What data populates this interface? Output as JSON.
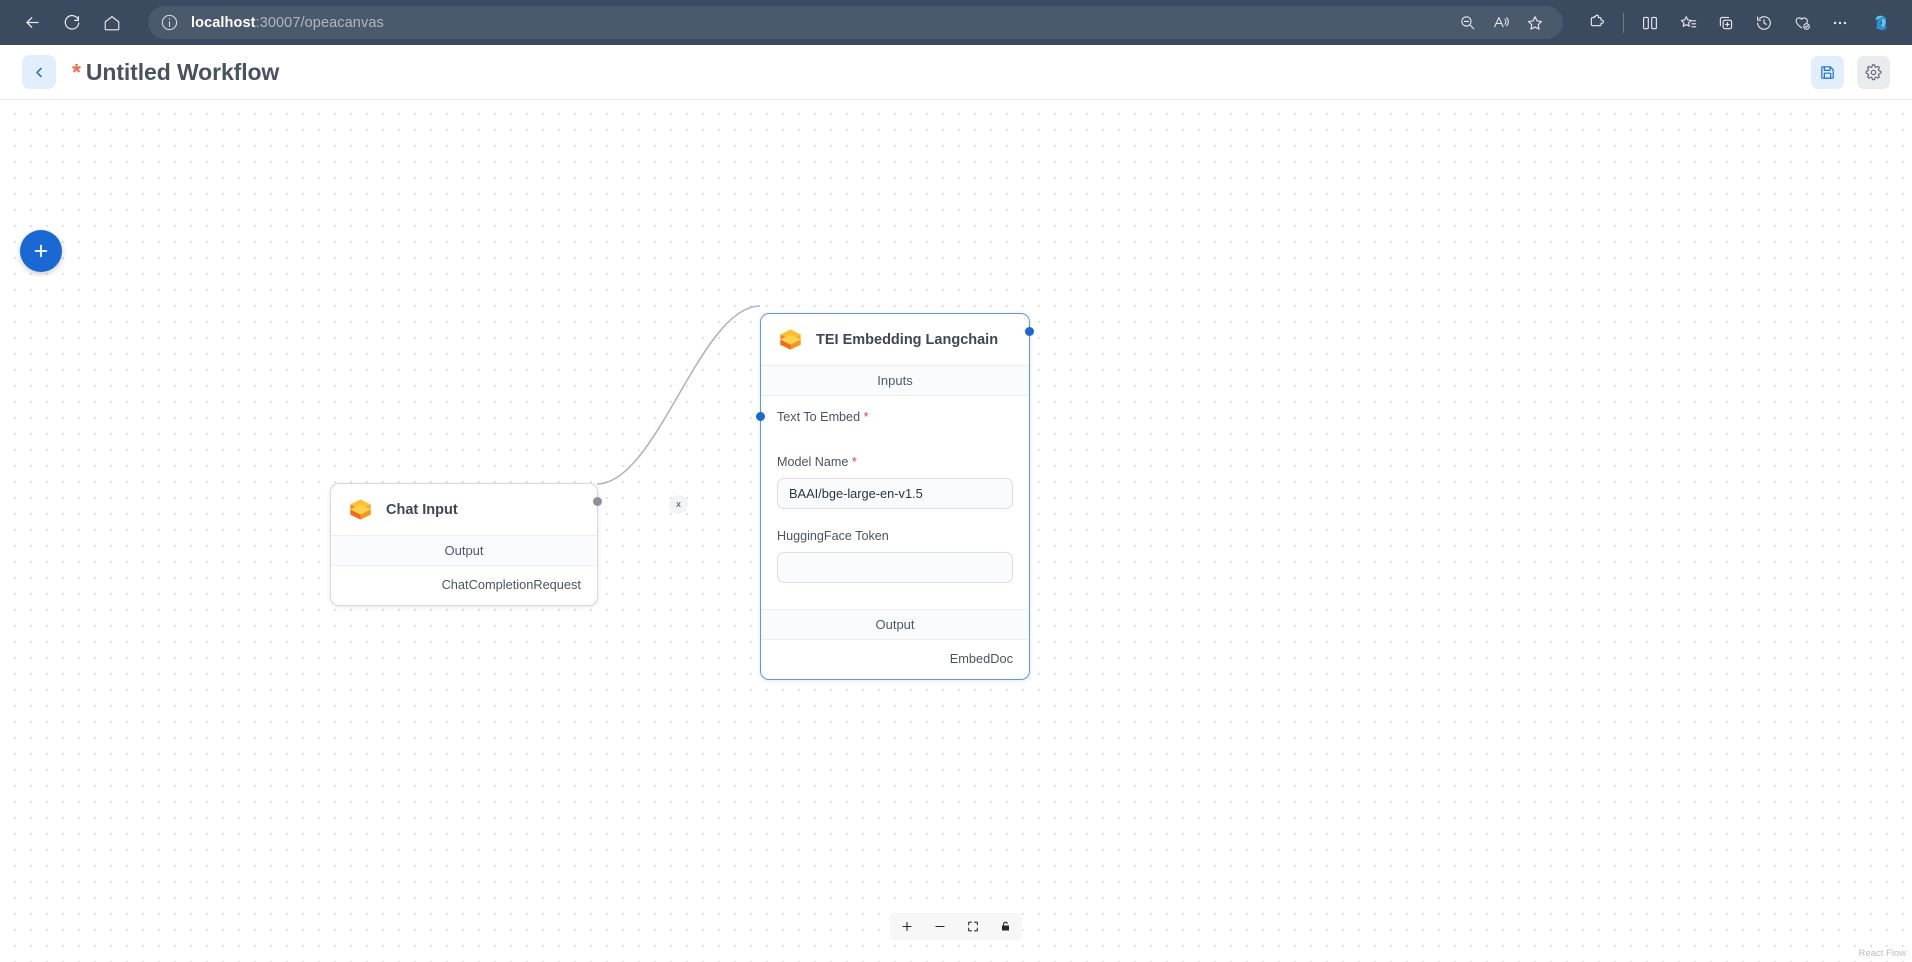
{
  "browser": {
    "back_label": "Back",
    "refresh_label": "Refresh",
    "home_label": "Home",
    "url_host": "localhost",
    "url_rest": ":30007/opeacanvas",
    "site_info_label": "View site information",
    "find_label": "Find on page",
    "read_aloud_label": "Read aloud",
    "favorite_label": "Add this page to favorites",
    "extensions_label": "Extensions",
    "split_screen_label": "Split screen",
    "collections_label": "Collections",
    "add_tab_label": "Browser essentials",
    "history_label": "History",
    "split_favorites_label": "Favorites",
    "settings_label": "Settings and more",
    "copilot_label": "Copilot"
  },
  "app_header": {
    "back_button_label": "Back to workflows",
    "unsaved_marker": "*",
    "title": "Untitled Workflow",
    "save_label": "Save workflow",
    "settings_label": "Workflow settings"
  },
  "canvas": {
    "add_node_label": "Add node",
    "attribution": "React Flow",
    "zoom_controls": {
      "zoom_in_label": "zoom in",
      "zoom_out_label": "zoom out",
      "fit_view_label": "fit view",
      "lock_label": "toggle interactivity"
    },
    "edge": {
      "delete_label": "x"
    }
  },
  "nodes": [
    {
      "id": "chat-input",
      "title": "Chat Input",
      "icon": "package-icon",
      "selected": false,
      "sections": {
        "output_label": "Output"
      },
      "outputs": [
        {
          "label": "ChatCompletionRequest",
          "handle": "grey"
        }
      ]
    },
    {
      "id": "tei-embedding-langchain",
      "title": "TEI Embedding Langchain",
      "icon": "package-icon",
      "selected": true,
      "sections": {
        "inputs_label": "Inputs",
        "output_label": "Output"
      },
      "inputs": [
        {
          "label": "Text To Embed",
          "required": true,
          "required_mark": "*",
          "type": "handle"
        },
        {
          "label": "Model Name",
          "required": true,
          "required_mark": "*",
          "type": "text",
          "value": "BAAI/bge-large-en-v1.5",
          "placeholder": ""
        },
        {
          "label": "HuggingFace Token",
          "required": false,
          "required_mark": "",
          "type": "text",
          "value": "",
          "placeholder": ""
        }
      ],
      "outputs": [
        {
          "label": "EmbedDoc",
          "handle": "blue"
        }
      ]
    }
  ],
  "colors": {
    "accent_blue": "#1a68d4",
    "selected_border": "#5d97e8",
    "required_red": "#e8384f",
    "unsaved_orange": "#f26b4e",
    "chrome_bg": "#3b4a5e",
    "node_icon_orange": "#f7941e"
  }
}
